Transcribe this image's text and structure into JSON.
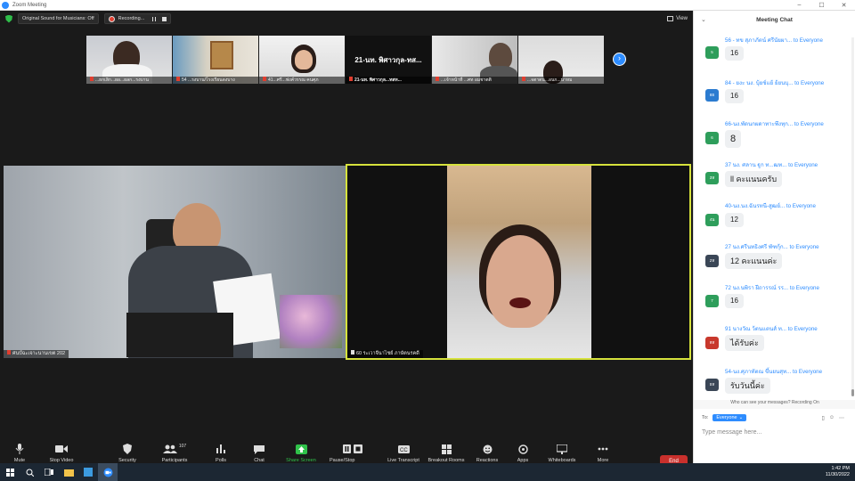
{
  "window": {
    "title": "Zoom Meeting",
    "controls": [
      "–",
      "☐",
      "✕"
    ]
  },
  "topbar": {
    "sound_label": "Original Sound for Musicians: Off",
    "recording_label": "Recording...",
    "view_label": "View"
  },
  "thumbnails": [
    {
      "name": "...ยกเลิก...ผอ...ผลก...รงบาน"
    },
    {
      "name": "54 ...รงบาน/โรงเรียนดงบาง"
    },
    {
      "name": "41...ศรี...ฟงค์วรรณ คนศุภ"
    },
    {
      "name": "21-นท. พิศาวกุล...ทสท...",
      "center_text": "21-นท. พิศาวกุล-ทส..."
    },
    {
      "name": "...เจ้าหน้าที่ ...ศท อมชาตติ"
    },
    {
      "name": "...จตาตน...อนก...นาหม"
    }
  ],
  "videos": {
    "left_label": "ศนป์ฉะเจาะนานเขต 202",
    "right_label": "60 ระเวาจีนาไชย์ ภาษัตนรคดี"
  },
  "toolbar": {
    "items": [
      {
        "label": "Mute",
        "icon": "microphone-icon"
      },
      {
        "label": "Stop Video",
        "icon": "video-camera-icon"
      },
      {
        "label": "Security",
        "icon": "shield-icon"
      },
      {
        "label": "Participants",
        "icon": "participants-icon",
        "count": "107"
      },
      {
        "label": "Polls",
        "icon": "polls-icon"
      },
      {
        "label": "Chat",
        "icon": "chat-icon"
      },
      {
        "label": "Share Screen",
        "icon": "share-screen-icon"
      },
      {
        "label": "Pause/Stop Recording",
        "icon": "pause-recording-icon"
      },
      {
        "label": "Live Transcript",
        "icon": "cc-icon"
      },
      {
        "label": "Breakout Rooms",
        "icon": "breakout-rooms-icon"
      },
      {
        "label": "Reactions",
        "icon": "reactions-icon"
      },
      {
        "label": "Apps",
        "icon": "apps-icon"
      },
      {
        "label": "Whiteboards",
        "icon": "whiteboard-icon"
      },
      {
        "label": "More",
        "icon": "more-icon"
      }
    ],
    "end_label": "End"
  },
  "chat": {
    "title": "Meeting Chat",
    "to_word": "to Everyone",
    "messages": [
      {
        "sender": "56 - ทข สุภาภัตน์ ศรีนัยผา...",
        "initials": "5",
        "color": "#2e9e5b",
        "text": "16"
      },
      {
        "sender": "84 - ยงะ นง. บุ้ยช์แย้ ย้ยนบุ...",
        "initials": "8ย",
        "color": "#2b7bd0",
        "text": "16"
      },
      {
        "sender": "66-นง.พัดนกผดาทาะพึงทุก...",
        "initials": "6",
        "color": "#2e9e5b",
        "text": "8"
      },
      {
        "sender": "37 นง. ศลาน ฐูก ท...ฒท...",
        "initials": "3ห",
        "color": "#2e9e5b",
        "text": "ll คะแนนครับ"
      },
      {
        "sender": "40-นง.นง.ฉันรทนี-สูฒย์...",
        "initials": "4น",
        "color": "#2e9e5b",
        "text": "12"
      },
      {
        "sender": "27 นง.ศรีนทธิงศรี พัฑกุ้ก...",
        "initials": "2ห",
        "color": "#3a4656",
        "text": "12 คะแนนค่ะ"
      },
      {
        "sender": "72 นง.นพิรา ฝีถารรณ์ รร...",
        "initials": "7",
        "color": "#2e9e5b",
        "text": "16"
      },
      {
        "sender": "91 นางวัณ ว้ตนแตนส์ ท...",
        "initials": "9ห",
        "color": "#c8382c",
        "text": "ได้รับค่ะ"
      },
      {
        "sender": "54-นง.ศุภาทัตณ ขึ้นยนสุท...",
        "initials": "5ห",
        "color": "#3a4656",
        "text": "รับวันนี้ค่ะ"
      }
    ],
    "who_can_see": "Who can see your messages? Recording On",
    "to_label": "To:",
    "to_value": "Everyone",
    "placeholder": "Type message here..."
  },
  "taskbar": {
    "time": "1:42 PM",
    "date": "11/30/2022"
  },
  "colors": {
    "accent": "#2d8cff",
    "end": "#c9302c",
    "active_speaker": "#d6e23c",
    "share_green": "#30c24a"
  }
}
